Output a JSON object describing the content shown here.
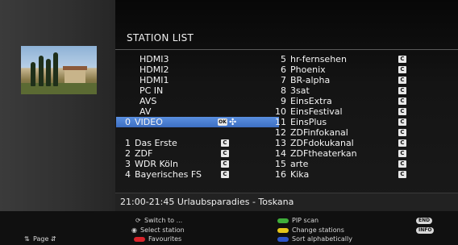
{
  "title": "STATION LIST",
  "left_column": [
    {
      "num": "",
      "name": "HDMI3"
    },
    {
      "num": "",
      "name": "HDMI2"
    },
    {
      "num": "",
      "name": "HDMI1"
    },
    {
      "num": "",
      "name": "PC IN"
    },
    {
      "num": "",
      "name": "AVS"
    },
    {
      "num": "",
      "name": "AV"
    },
    {
      "num": "0",
      "name": "VIDEO",
      "selected": true,
      "ok_badge": "OK"
    },
    {
      "num": "1",
      "name": "Das Erste",
      "c_badge": "C"
    },
    {
      "num": "2",
      "name": "ZDF",
      "c_badge": "C"
    },
    {
      "num": "3",
      "name": "WDR Köln",
      "c_badge": "C"
    },
    {
      "num": "4",
      "name": "Bayerisches FS",
      "c_badge": "C"
    }
  ],
  "right_column": [
    {
      "num": "5",
      "name": "hr-fernsehen",
      "c_badge": "C"
    },
    {
      "num": "6",
      "name": "Phoenix",
      "c_badge": "C"
    },
    {
      "num": "7",
      "name": "BR-alpha",
      "c_badge": "C"
    },
    {
      "num": "8",
      "name": "3sat",
      "c_badge": "C"
    },
    {
      "num": "9",
      "name": "EinsExtra",
      "c_badge": "C"
    },
    {
      "num": "10",
      "name": "EinsFestival",
      "c_badge": "C"
    },
    {
      "num": "11",
      "name": "EinsPlus",
      "c_badge": "C"
    },
    {
      "num": "12",
      "name": "ZDFinfokanal",
      "c_badge": "C"
    },
    {
      "num": "13",
      "name": "ZDFdokukanal",
      "c_badge": "C"
    },
    {
      "num": "14",
      "name": "ZDFtheaterkan",
      "c_badge": "C"
    },
    {
      "num": "15",
      "name": "arte",
      "c_badge": "C"
    },
    {
      "num": "16",
      "name": "Kika",
      "c_badge": "C"
    }
  ],
  "epg_text": "21:00-21:45 Urlaubsparadies - Toskana",
  "footer": {
    "page": "Page",
    "switch_to": "Switch to ...",
    "select_station": "Select station",
    "favourites": "Favourites",
    "pip_scan": "PIP scan",
    "change_stations": "Change stations",
    "sort_alphabetically": "Sort alphabetically",
    "end_key": "END",
    "info_key": "INFO"
  },
  "colors": {
    "selection": "#4a7fd4",
    "red": "#d8232a",
    "green": "#3fae3a",
    "yellow": "#e6c619",
    "blue": "#2d54c8"
  }
}
